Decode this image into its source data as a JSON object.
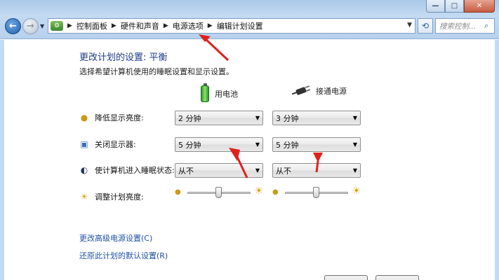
{
  "window": {
    "minimize_glyph": "—",
    "maximize_glyph": "□",
    "close_glyph": "✕"
  },
  "navbar": {
    "back_glyph": "←",
    "forward_glyph": "→",
    "breadcrumbs": [
      "控制面板",
      "硬件和声音",
      "电源选项",
      "编辑计划设置"
    ],
    "search_placeholder": "搜索控制...",
    "icons": [
      "back-arrow-icon",
      "forward-arrow-icon",
      "control-panel-icon",
      "refresh-icon",
      "search-icon"
    ]
  },
  "page": {
    "title": "更改计划的设置: 平衡",
    "subtitle": "选择希望计算机使用的睡眠设置和显示设置。"
  },
  "columns": {
    "battery": "用电池",
    "plugged_in": "接通电源"
  },
  "settings": [
    {
      "label": "降低显示亮度:",
      "icon": "dim-display-icon",
      "battery": "2 分钟",
      "plugged_in": "3 分钟"
    },
    {
      "label": "关闭显示器:",
      "icon": "monitor-icon",
      "battery": "5 分钟",
      "plugged_in": "5 分钟"
    },
    {
      "label": "使计算机进入睡眠状态:",
      "icon": "sleep-moon-icon",
      "battery": "从不",
      "plugged_in": "从不"
    }
  ],
  "brightness": {
    "label": "调整计划亮度:",
    "battery_level": 0.5,
    "plugged_in_level": 0.5
  },
  "links": {
    "advanced": "更改高级电源设置(C)",
    "restore": "还原此计划的默认设置(R)"
  },
  "colors": {
    "link": "#1f4fa8",
    "title": "#1f3d8a",
    "annotation_arrow": "#e0201b"
  }
}
